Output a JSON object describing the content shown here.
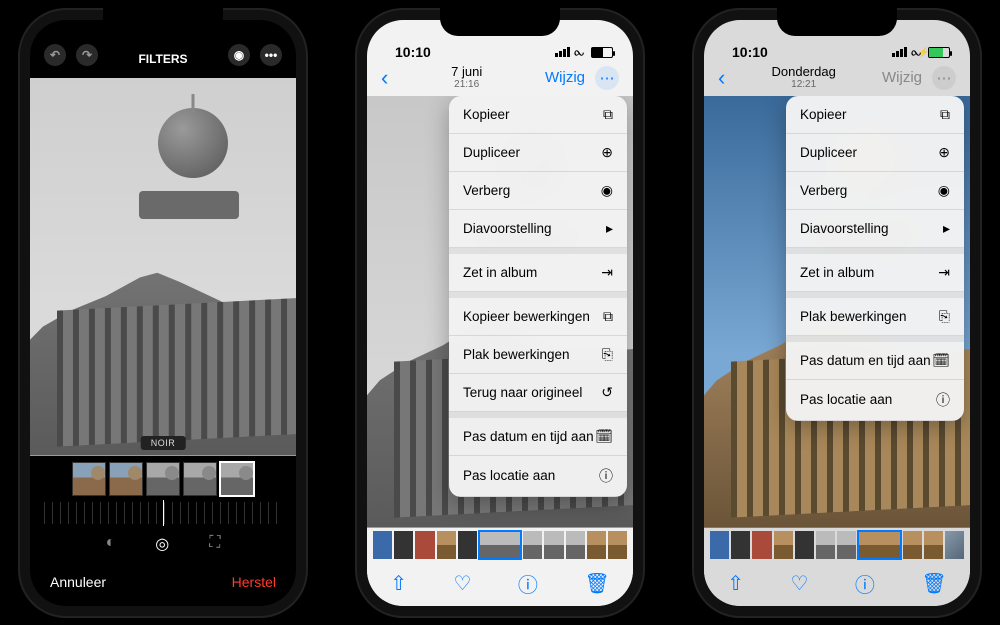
{
  "phone1": {
    "title": "FILTERS",
    "filter_name": "NOIR",
    "cancel": "Annuleer",
    "reset": "Herstel",
    "undo_icon": "↶",
    "redo_icon": "↷",
    "location_icon": "◉",
    "more_icon": "•••",
    "mode_adjust_icon": "◐",
    "mode_filters_icon": "◎",
    "mode_crop_icon": "⛶"
  },
  "phone2": {
    "clock": "10:10",
    "date": "7 juni",
    "subtitle": "21:16",
    "edit": "Wijzig",
    "menu": [
      {
        "label": "Kopieer",
        "icon": "⧉"
      },
      {
        "label": "Dupliceer",
        "icon": "⊕"
      },
      {
        "label": "Verberg",
        "icon": "◉"
      },
      {
        "label": "Diavoorstelling",
        "icon": "▸"
      },
      {
        "sep": true
      },
      {
        "label": "Zet in album",
        "icon": "⇥"
      },
      {
        "sep": true
      },
      {
        "label": "Kopieer bewerkingen",
        "icon": "⧉"
      },
      {
        "label": "Plak bewerkingen",
        "icon": "⎘"
      },
      {
        "label": "Terug naar origineel",
        "icon": "↺"
      },
      {
        "sep": true
      },
      {
        "label": "Pas datum en tijd aan",
        "icon": "🗓"
      },
      {
        "label": "Pas locatie aan",
        "icon": "ⓘ"
      }
    ]
  },
  "phone3": {
    "clock": "10:10",
    "date": "Donderdag",
    "subtitle": "12:21",
    "edit": "Wijzig",
    "menu": [
      {
        "label": "Kopieer",
        "icon": "⧉"
      },
      {
        "label": "Dupliceer",
        "icon": "⊕"
      },
      {
        "label": "Verberg",
        "icon": "◉"
      },
      {
        "label": "Diavoorstelling",
        "icon": "▸"
      },
      {
        "sep": true
      },
      {
        "label": "Zet in album",
        "icon": "⇥"
      },
      {
        "sep": true
      },
      {
        "label": "Plak bewerkingen",
        "icon": "⎘"
      },
      {
        "sep": true
      },
      {
        "label": "Pas datum en tijd aan",
        "icon": "🗓"
      },
      {
        "label": "Pas locatie aan",
        "icon": "ⓘ"
      }
    ]
  },
  "tabbar": {
    "share_icon": "⇧",
    "heart_icon": "♡",
    "info_icon": "ⓘ",
    "trash_icon": "🗑"
  }
}
